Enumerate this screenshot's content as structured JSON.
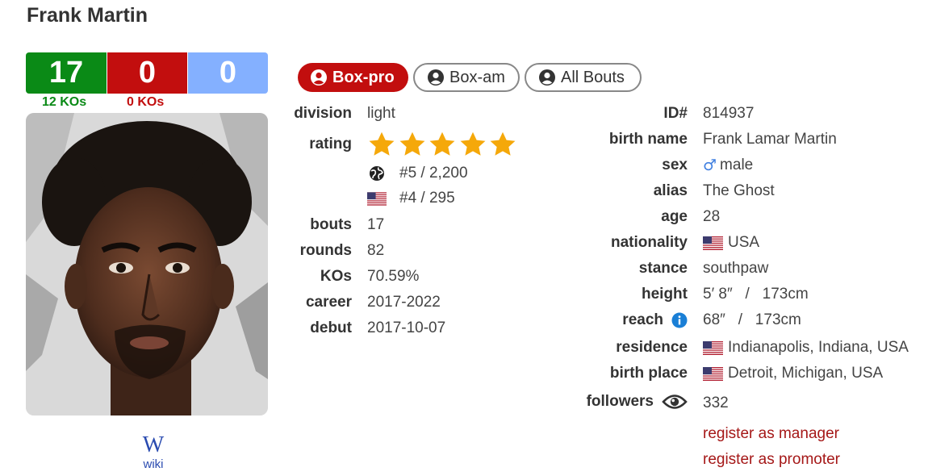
{
  "boxer": {
    "name": "Frank Martin"
  },
  "record": {
    "wins": "17",
    "losses": "0",
    "draws": "0",
    "wins_kos": "12 KOs",
    "losses_kos": "0 KOs",
    "colors": {
      "win": "#0a8a16",
      "loss": "#c20e0e",
      "draw": "#84b0ff"
    }
  },
  "wiki": {
    "label": "wiki",
    "logo_letter": "W"
  },
  "tabs": [
    {
      "label": "Box-pro",
      "active": true,
      "icon": "user-circle-icon"
    },
    {
      "label": "Box-am",
      "active": false,
      "icon": "user-circle-icon"
    },
    {
      "label": "All Bouts",
      "active": false,
      "icon": "user-circle-icon"
    }
  ],
  "left": {
    "division_label": "division",
    "division": "light",
    "rating_label": "rating",
    "rating_stars": 5,
    "world_rank": "#5 / 2,200",
    "country_rank": "#4 / 295",
    "bouts_label": "bouts",
    "bouts": "17",
    "rounds_label": "rounds",
    "rounds": "82",
    "kos_label": "KOs",
    "kos": "70.59%",
    "career_label": "career",
    "career": "2017-2022",
    "debut_label": "debut",
    "debut": "2017-10-07"
  },
  "right": {
    "id_label": "ID#",
    "id": "814937",
    "birthname_label": "birth name",
    "birthname": "Frank Lamar Martin",
    "sex_label": "sex",
    "sex": "male",
    "alias_label": "alias",
    "alias": "The Ghost",
    "age_label": "age",
    "age": "28",
    "nationality_label": "nationality",
    "nationality": "USA",
    "stance_label": "stance",
    "stance": "southpaw",
    "height_label": "height",
    "height": "5′ 8″   /   173cm",
    "reach_label": "reach",
    "reach": "68″   /   173cm",
    "residence_label": "residence",
    "residence": "Indianapolis, Indiana, USA",
    "birthplace_label": "birth place",
    "birthplace": "Detroit, Michigan, USA",
    "followers_label": "followers",
    "followers": "332",
    "register_manager": "register as manager",
    "register_promoter": "register as promoter"
  }
}
